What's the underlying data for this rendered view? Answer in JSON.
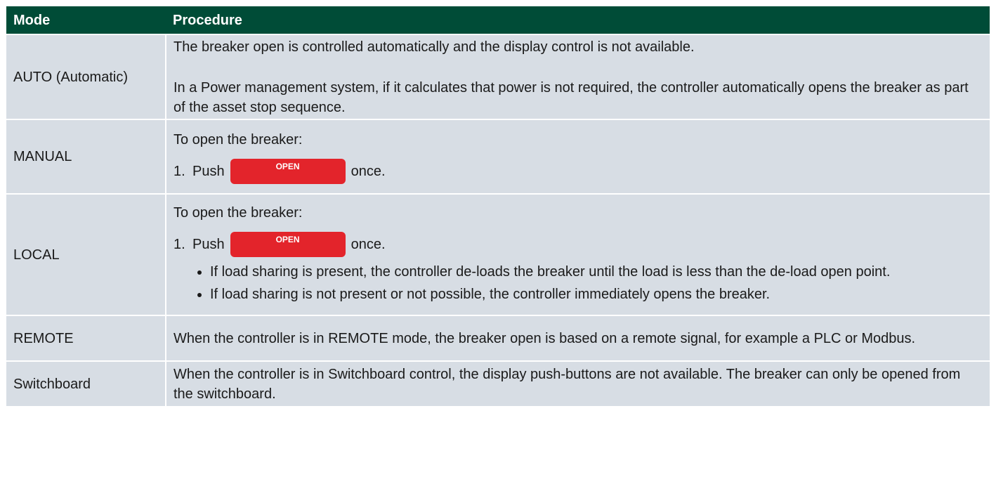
{
  "table": {
    "headers": {
      "mode": "Mode",
      "procedure": "Procedure"
    },
    "rows": {
      "auto": {
        "mode": "AUTO (Automatic)",
        "p1": "The breaker open is controlled automatically and the display control is not available.",
        "p2": "In a Power management system, if it calculates that power is not required, the controller automatically opens the breaker as part of the asset stop sequence."
      },
      "manual": {
        "mode": "MANUAL",
        "intro": "To open the breaker:",
        "step_num": "1.",
        "step_push": "Push",
        "button": "OPEN",
        "step_after": "once."
      },
      "local": {
        "mode": "LOCAL",
        "intro": "To open the breaker:",
        "step_num": "1.",
        "step_push": "Push",
        "button": "OPEN",
        "step_after": "once.",
        "bullets": [
          "If load sharing is present, the controller de-loads the breaker until the load is less than the de-load open point.",
          "If load sharing is not present or not possible, the controller immediately opens the breaker."
        ]
      },
      "remote": {
        "mode": "REMOTE",
        "text": "When the controller is in REMOTE mode, the breaker open is based on a remote signal, for example a PLC or Modbus."
      },
      "switchboard": {
        "mode": "Switchboard",
        "text": "When the controller is in Switchboard control, the display push-buttons are not available. The breaker can only be opened from the switchboard."
      }
    }
  },
  "colors": {
    "header_bg": "#004c37",
    "row_bg": "#d7dde4",
    "button_bg": "#e3242b"
  }
}
